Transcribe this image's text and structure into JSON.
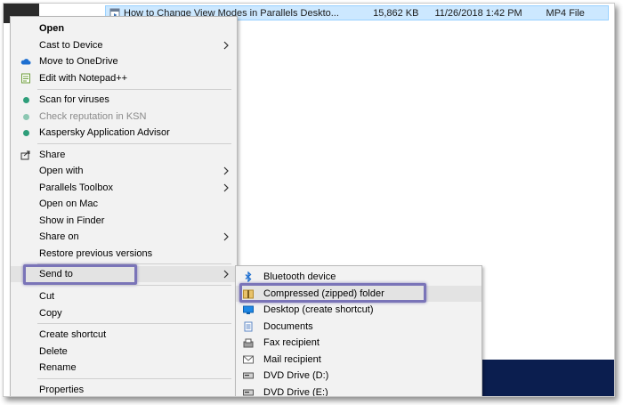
{
  "explorer": {
    "file": {
      "name": "How to Change View Modes in Parallels Deskto...",
      "size": "15,862 KB",
      "date": "11/26/2018 1:42 PM",
      "type": "MP4 File"
    }
  },
  "context_menu": {
    "open": "Open",
    "cast_to_device": "Cast to Device",
    "move_to_onedrive": "Move to OneDrive",
    "edit_with_notepad": "Edit with Notepad++",
    "scan_for_viruses": "Scan for viruses",
    "check_reputation": "Check reputation in KSN",
    "kaspersky_advisor": "Kaspersky Application Advisor",
    "share": "Share",
    "open_with": "Open with",
    "parallels_toolbox": "Parallels Toolbox",
    "open_on_mac": "Open on Mac",
    "show_in_finder": "Show in Finder",
    "share_on": "Share on",
    "restore_previous_versions": "Restore previous versions",
    "send_to": "Send to",
    "cut": "Cut",
    "copy": "Copy",
    "create_shortcut": "Create shortcut",
    "delete": "Delete",
    "rename": "Rename",
    "properties": "Properties"
  },
  "send_to_menu": {
    "bluetooth": "Bluetooth device",
    "compressed": "Compressed (zipped) folder",
    "desktop": "Desktop (create shortcut)",
    "documents": "Documents",
    "fax": "Fax recipient",
    "mail": "Mail recipient",
    "dvd_d": "DVD Drive (D:)",
    "dvd_e": "DVD Drive (E:)"
  },
  "colors": {
    "menu_background": "#f2f2f2",
    "selection_row": "#cce8ff",
    "highlight_outline": "#7a74b8",
    "kaspersky_green": "#2e9e7a",
    "taskbar": "#0b1e4f"
  }
}
